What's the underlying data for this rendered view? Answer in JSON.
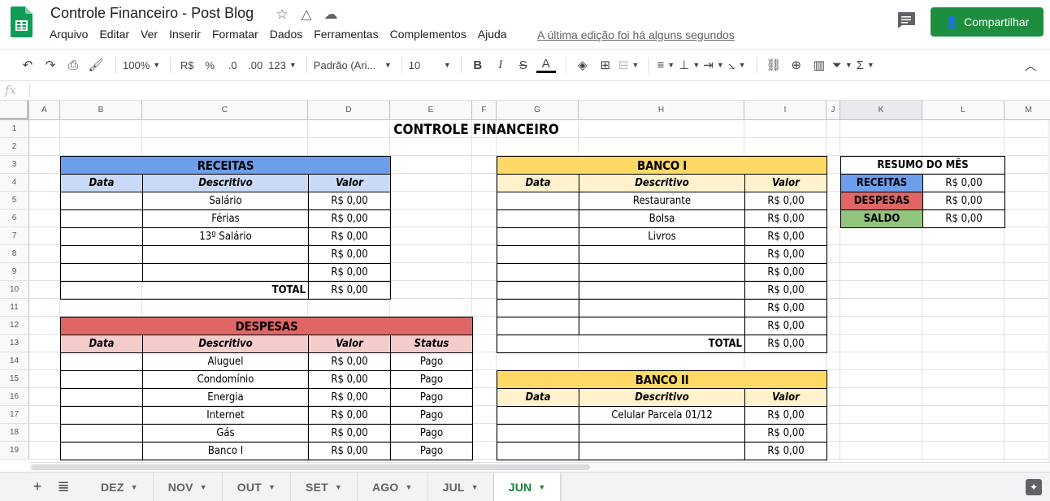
{
  "app": {
    "title": "Controle Financeiro - Post Blog",
    "last_edit": "A última edição foi há alguns segundos",
    "share_label": "Compartilhar"
  },
  "menu": [
    "Arquivo",
    "Editar",
    "Ver",
    "Inserir",
    "Formatar",
    "Dados",
    "Ferramentas",
    "Complementos",
    "Ajuda"
  ],
  "toolbar": {
    "zoom": "100%",
    "currency": "R$",
    "percent": "%",
    "dec_less": ".0",
    "dec_more": ".00",
    "format_more": "123",
    "font": "Padrão (Ari...",
    "font_size": "10"
  },
  "formula_bar": {
    "fx": "fx",
    "value": ""
  },
  "columns": [
    "A",
    "B",
    "C",
    "D",
    "E",
    "F",
    "G",
    "H",
    "I",
    "J",
    "K",
    "L",
    "M"
  ],
  "selected_column": "K",
  "rows": [
    "1",
    "2",
    "3",
    "4",
    "5",
    "6",
    "7",
    "8",
    "9",
    "10",
    "11",
    "12",
    "13",
    "14",
    "15",
    "16",
    "17",
    "18",
    "19"
  ],
  "sheet": {
    "title": "CONTROLE FINANCEIRO",
    "receitas": {
      "header": "RECEITAS",
      "cols": [
        "Data",
        "Descritivo",
        "Valor"
      ],
      "rows": [
        {
          "data": "",
          "desc": "Salário",
          "valor": "R$ 0,00"
        },
        {
          "data": "",
          "desc": "Férias",
          "valor": "R$ 0,00"
        },
        {
          "data": "",
          "desc": "13º Salário",
          "valor": "R$ 0,00"
        },
        {
          "data": "",
          "desc": "",
          "valor": "R$ 0,00"
        },
        {
          "data": "",
          "desc": "",
          "valor": "R$ 0,00"
        }
      ],
      "total_label": "TOTAL",
      "total_value": "R$ 0,00"
    },
    "despesas": {
      "header": "DESPESAS",
      "cols": [
        "Data",
        "Descritivo",
        "Valor",
        "Status"
      ],
      "rows": [
        {
          "data": "",
          "desc": "Aluguel",
          "valor": "R$ 0,00",
          "status": "Pago"
        },
        {
          "data": "",
          "desc": "Condomínio",
          "valor": "R$ 0,00",
          "status": "Pago"
        },
        {
          "data": "",
          "desc": "Energia",
          "valor": "R$ 0,00",
          "status": "Pago"
        },
        {
          "data": "",
          "desc": "Internet",
          "valor": "R$ 0,00",
          "status": "Pago"
        },
        {
          "data": "",
          "desc": "Gás",
          "valor": "R$ 0,00",
          "status": "Pago"
        },
        {
          "data": "",
          "desc": "Banco I",
          "valor": "R$ 0,00",
          "status": "Pago"
        }
      ]
    },
    "banco1": {
      "header": "BANCO I",
      "cols": [
        "Data",
        "Descritivo",
        "Valor"
      ],
      "rows": [
        {
          "data": "",
          "desc": "Restaurante",
          "valor": "R$ 0,00"
        },
        {
          "data": "",
          "desc": "Bolsa",
          "valor": "R$ 0,00"
        },
        {
          "data": "",
          "desc": "Livros",
          "valor": "R$ 0,00"
        },
        {
          "data": "",
          "desc": "",
          "valor": "R$ 0,00"
        },
        {
          "data": "",
          "desc": "",
          "valor": "R$ 0,00"
        },
        {
          "data": "",
          "desc": "",
          "valor": "R$ 0,00"
        },
        {
          "data": "",
          "desc": "",
          "valor": "R$ 0,00"
        },
        {
          "data": "",
          "desc": "",
          "valor": "R$ 0,00"
        }
      ],
      "total_label": "TOTAL",
      "total_value": "R$ 0,00"
    },
    "banco2": {
      "header": "BANCO II",
      "cols": [
        "Data",
        "Descritivo",
        "Valor"
      ],
      "rows": [
        {
          "data": "",
          "desc": "Celular Parcela 01/12",
          "valor": "R$ 0,00"
        },
        {
          "data": "",
          "desc": "",
          "valor": "R$ 0,00"
        },
        {
          "data": "",
          "desc": "",
          "valor": "R$ 0,00"
        }
      ]
    },
    "resumo": {
      "header": "RESUMO DO MÊS",
      "rows": [
        {
          "label": "RECEITAS",
          "value": "R$ 0,00"
        },
        {
          "label": "DESPESAS",
          "value": "R$ 0,00"
        },
        {
          "label": "SALDO",
          "value": "R$ 0,00"
        }
      ]
    }
  },
  "colors": {
    "receitas_header": "#6d9eeb",
    "receitas_sub": "#c9daf8",
    "despesas_header": "#e06666",
    "despesas_sub": "#f4cccc",
    "banco_header": "#ffd966",
    "banco_sub": "#fff2cc",
    "saldo": "#93c47d",
    "share_green": "#1e8e3e",
    "active_tab": "#188038"
  },
  "sheet_tabs": [
    "DEZ",
    "NOV",
    "OUT",
    "SET",
    "AGO",
    "JUL",
    "JUN"
  ],
  "active_tab": "JUN"
}
